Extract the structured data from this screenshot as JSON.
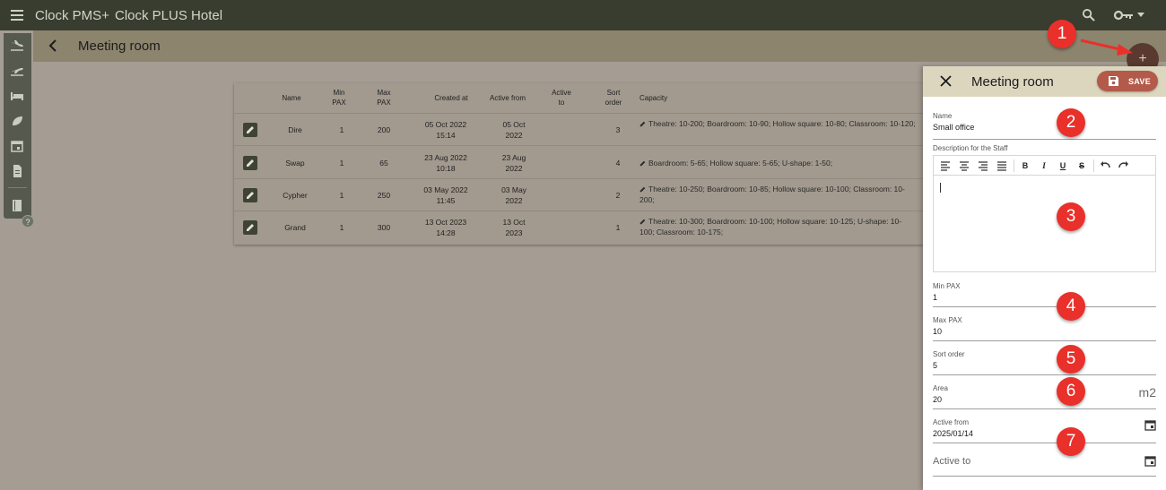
{
  "topbar": {
    "app_name": "Clock PMS+",
    "hotel_name": "Clock PLUS Hotel",
    "icons": [
      "menu-icon",
      "search-icon",
      "key-icon",
      "caret-down-icon"
    ]
  },
  "subheader": {
    "title": "Meeting room"
  },
  "rail": {
    "icons": [
      "arrivals-icon",
      "departures-icon",
      "bed-icon",
      "leaf-icon",
      "calendar-icon",
      "document-icon",
      "book-icon"
    ],
    "help_label": "?"
  },
  "table": {
    "columns": [
      {
        "key": "name",
        "label": "Name"
      },
      {
        "key": "min_pax",
        "label": "Min PAX"
      },
      {
        "key": "max_pax",
        "label": "Max PAX"
      },
      {
        "key": "created_at",
        "label": "Created at"
      },
      {
        "key": "active_from",
        "label": "Active from"
      },
      {
        "key": "active_to",
        "label": "Active to"
      },
      {
        "key": "sort_order",
        "label": "Sort order"
      },
      {
        "key": "capacity",
        "label": "Capacity"
      }
    ],
    "rows": [
      {
        "name": "Dire",
        "min_pax": "1",
        "max_pax": "200",
        "created_date": "05 Oct 2022",
        "created_time": "15:14",
        "active_from_1": "05 Oct",
        "active_from_2": "2022",
        "active_to": "",
        "sort_order": "3",
        "capacity": "Theatre: 10-200; Boardroom: 10-90; Hollow square: 10-80; Classroom: 10-120;"
      },
      {
        "name": "Swap",
        "min_pax": "1",
        "max_pax": "65",
        "created_date": "23 Aug 2022",
        "created_time": "10:18",
        "active_from_1": "23 Aug",
        "active_from_2": "2022",
        "active_to": "",
        "sort_order": "4",
        "capacity": "Boardroom: 5-65; Hollow square: 5-65; U-shape: 1-50;"
      },
      {
        "name": "Cypher",
        "min_pax": "1",
        "max_pax": "250",
        "created_date": "03 May 2022",
        "created_time": "11:45",
        "active_from_1": "03 May",
        "active_from_2": "2022",
        "active_to": "",
        "sort_order": "2",
        "capacity": "Theatre: 10-250; Boardroom: 10-85; Hollow square: 10-100; Classroom: 10-200;"
      },
      {
        "name": "Grand",
        "min_pax": "1",
        "max_pax": "300",
        "created_date": "13 Oct 2023",
        "created_time": "14:28",
        "active_from_1": "13 Oct",
        "active_from_2": "2023",
        "active_to": "",
        "sort_order": "1",
        "capacity": "Theatre: 10-300; Boardroom: 10-100; Hollow square: 10-125; U-shape: 10-100; Classroom: 10-175;"
      }
    ]
  },
  "fab": {
    "label": "+"
  },
  "badges": [
    "1",
    "2",
    "3",
    "4",
    "5",
    "6",
    "7"
  ],
  "panel": {
    "title": "Meeting room",
    "save_label": "SAVE",
    "name": {
      "label": "Name",
      "value": "Small office"
    },
    "description": {
      "label": "Description for the Staff",
      "value": ""
    },
    "toolbar": [
      "align-left-icon",
      "align-center-icon",
      "align-right-icon",
      "align-justify-icon",
      "bold-icon",
      "italic-icon",
      "underline-icon",
      "strikethrough-icon",
      "undo-icon",
      "redo-icon"
    ],
    "min_pax": {
      "label": "Min PAX",
      "value": "1"
    },
    "max_pax": {
      "label": "Max PAX",
      "value": "10"
    },
    "sort_order": {
      "label": "Sort order",
      "value": "5"
    },
    "area": {
      "label": "Area",
      "value": "20",
      "unit": "m2"
    },
    "active_from": {
      "label": "Active from",
      "value": "2025/01/14"
    },
    "active_to": {
      "label": "Active to",
      "value": ""
    }
  },
  "colors": {
    "topbar": "#393d2f",
    "subheader": "#8d846e",
    "overlay_bg": "#a59d93",
    "panel_header": "#dcd6bf",
    "save_button": "#b35a4a",
    "badge": "#e9302a"
  }
}
